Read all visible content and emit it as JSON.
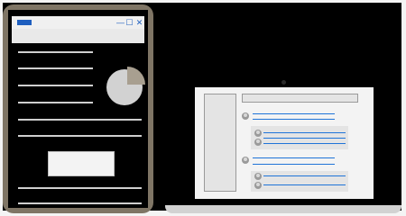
{
  "illustration": {
    "description_icons": [
      "tablet-device",
      "laptop-device"
    ]
  },
  "tablet_window": {
    "minimize_glyph": "—",
    "maximize_glyph": "☐",
    "close_glyph": "✕"
  },
  "colors": {
    "accent": "#1f5fbf",
    "tablet_frame": "#7f7565",
    "message_line": "#1f74d8"
  }
}
